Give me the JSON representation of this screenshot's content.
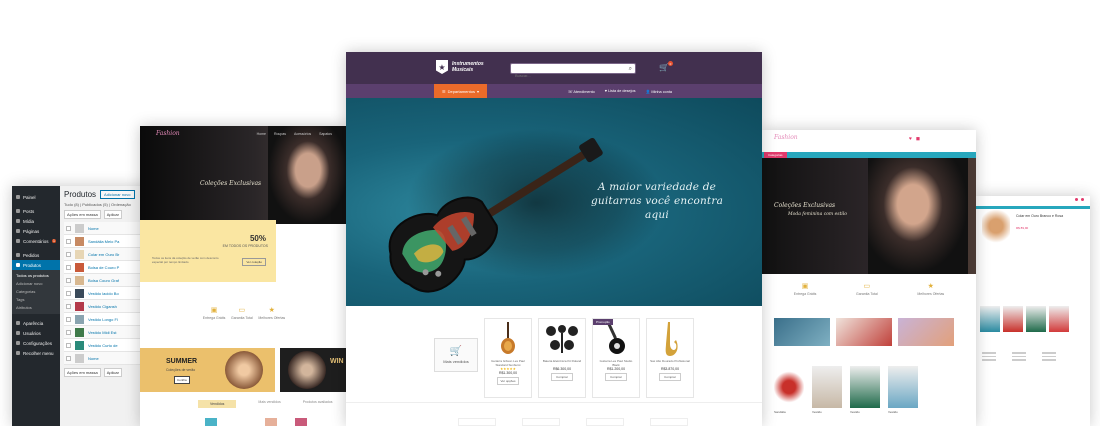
{
  "wp_admin": {
    "menu": [
      "Painel",
      "Posts",
      "Mídia",
      "Páginas",
      "Comentários",
      "Pedidos",
      "Produtos",
      "Aparência",
      "Usuários",
      "Configurações",
      "Recolher menu"
    ],
    "comments_badge": "1",
    "products_submenu": [
      "Todos os produtos",
      "Adicionar novo",
      "Categorias",
      "Tags",
      "Atributos"
    ],
    "page_title": "Produtos",
    "add_new_button": "Adicionar novo",
    "filters": "Tudo (8) | Publicados (5) | Ordenação",
    "bulk_actions": "Ações em massa",
    "apply_button": "Aplicar",
    "column_name": "Nome",
    "products": [
      "Sandália Meio Pa",
      "Colar em Ouro Br",
      "Bolsa de Couro P",
      "Bolsa Couro Graf",
      "Vestido lacido Bo",
      "Vestido Cigansh",
      "Vestido Longo Fl",
      "Vestido Midi Est",
      "Vestido Curto de"
    ],
    "footer_column": "Nome"
  },
  "fashion_left": {
    "logo": "Fashion",
    "nav": [
      "Home",
      "Roupas",
      "Acessórios",
      "Sapatos"
    ],
    "hero_text": "Coleções Exclusivas",
    "promo_percent": "50%",
    "promo_subtitle": "EM TODOS OS PRODUTOS",
    "promo_body": "Todos os itens da coleção de verão com desconto especial por tempo limitado",
    "promo_button": "Ver coleção",
    "features": [
      "Entrega Grátis",
      "Garantia Total",
      "Melhores Ofertas"
    ],
    "summer_title": "SUMMER",
    "summer_sub": "Coleções de verão",
    "summer_button": "Confira",
    "winter_title": "WIN",
    "tabs": [
      "Vendidos",
      "Mais vendidos",
      "Produtos avaliados"
    ]
  },
  "shop": {
    "brand_line1": "Instrumentos",
    "brand_line2": "Musicais",
    "search_placeholder": "Buscar...",
    "cart_count": "0",
    "departments_button": "Departamentos",
    "top_links": [
      "Atendimento",
      "Lista de desejos",
      "Minha conta"
    ],
    "hero_tagline": "A maior variedade de guitarras você encontra aqui",
    "best_sellers": "Mais vendidos",
    "products": [
      {
        "name": "Guitarra Gibson Les Paul Standard Sunburst",
        "rating": "★★★★★",
        "price": "R$1.300,00",
        "button": "Ver opções",
        "promo": ""
      },
      {
        "name": "Bateria Eletrônica Kit Roland",
        "rating": "",
        "price": "R$6.300,00",
        "button": "Comprar",
        "promo": ""
      },
      {
        "name": "Guitarra Les Paul Studio Black",
        "rating": "",
        "price": "R$1.200,00",
        "button": "Comprar",
        "promo": "Promoção"
      },
      {
        "name": "Sax Alto Dourado Profissional",
        "rating": "",
        "price": "R$3.870,00",
        "button": "Comprar",
        "promo": ""
      }
    ]
  },
  "fashion_right": {
    "logo": "Fashion",
    "category_button": "Categorias",
    "hero_text": "Coleções Exclusivas",
    "hero_sub": "Moda feminina com estilo",
    "features": [
      "Entrega Grátis",
      "Garantia Total",
      "Melhores Ofertas"
    ],
    "product_labels": [
      "Sandália",
      "Vestido",
      "Vestido",
      "Vestido"
    ]
  },
  "product_page": {
    "title": "Colar em Ouro Branco e Rosa",
    "price": "R$ 89,90"
  }
}
